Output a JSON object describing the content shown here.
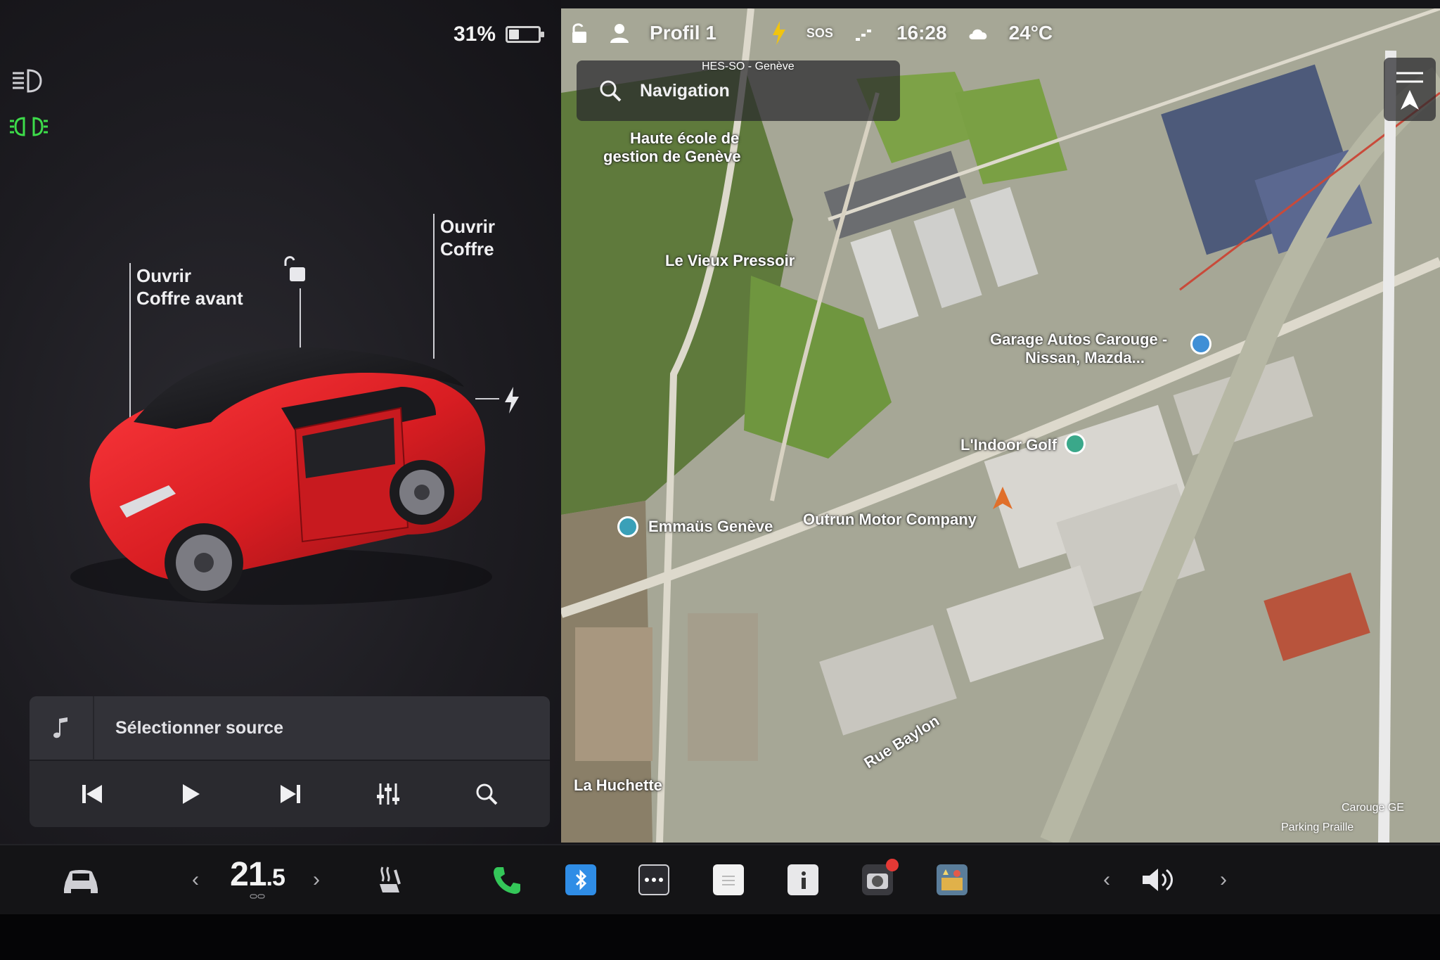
{
  "status": {
    "battery_percent": "31%",
    "battery_level": 0.31,
    "profile": "Profil 1",
    "sos": "SOS",
    "time": "16:28",
    "temperature_outside": "24°C"
  },
  "car_panel": {
    "open_frunk_line1": "Ouvrir",
    "open_frunk_line2": "Coffre avant",
    "open_trunk_line1": "Ouvrir",
    "open_trunk_line2": "Coffre",
    "car_color": "#d81d22"
  },
  "media": {
    "source_label": "Sélectionner source"
  },
  "map": {
    "search_placeholder": "Navigation",
    "labels": {
      "hes_so": "HES-SO - Genève",
      "haute_ecole": "Haute école de",
      "gestion": "gestion de Genève",
      "vieux_pressoir": "Le Vieux Pressoir",
      "garage_line1": "Garage Autos Carouge -",
      "garage_line2": "Nissan, Mazda...",
      "indoor_golf": "L'Indoor Golf",
      "emmaus": "Emmaüs Genève",
      "outrun": "Outrun Motor Company",
      "rue_bayon": "Rue Baylon",
      "la_huchette": "La Huchette",
      "carouge_ge": "Carouge GE",
      "parking": "Parking Praille"
    }
  },
  "taskbar": {
    "cabin_temp_int": "21",
    "cabin_temp_dec": ".5",
    "left_arrow": "‹",
    "right_arrow": "›",
    "vol_left": "‹",
    "vol_right": "›"
  },
  "colors": {
    "accent_green": "#3ddc4a",
    "bluetooth_blue": "#2f8de6",
    "phone_green": "#34c759",
    "nav_arrow": "#e06f2a"
  }
}
